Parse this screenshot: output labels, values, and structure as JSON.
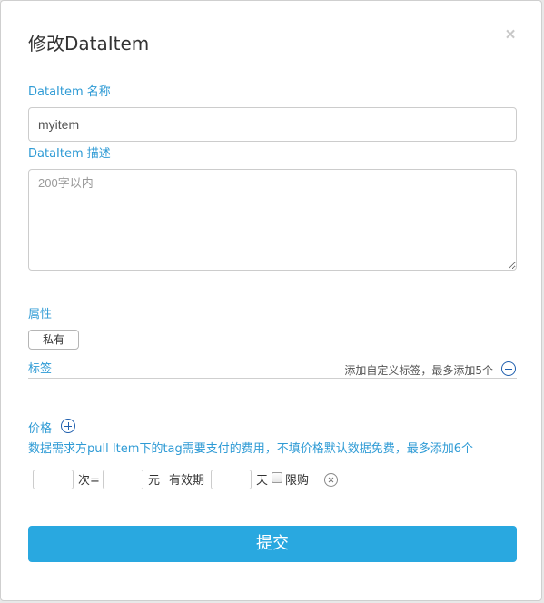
{
  "dialog": {
    "title": "修改DataItem",
    "close_symbol": "×"
  },
  "name_field": {
    "label": "DataItem 名称",
    "value": "myitem"
  },
  "description_field": {
    "label": "DataItem 描述",
    "value": "",
    "placeholder": "200字以内"
  },
  "attributes": {
    "label": "属性",
    "private_button": "私有"
  },
  "tags": {
    "label": "标签",
    "add_hint": "添加自定义标签，最多添加5个"
  },
  "price": {
    "label": "价格",
    "hint": "数据需求方pull Item下的tag需要支付的费用，不填价格默认数据免费，最多添加6个",
    "row": {
      "times_value": "",
      "times_unit": "次=",
      "amount_value": "",
      "currency_unit": "元",
      "validity_label": "有效期",
      "days_value": "",
      "days_unit": "天",
      "limit_label": "限购",
      "limit_checked": false
    }
  },
  "submit_label": "提交",
  "icons": {
    "close": "close-icon",
    "add_tag": "plus-circle-icon",
    "add_price": "plus-circle-icon",
    "remove_price": "remove-circle-icon"
  },
  "colors": {
    "accent_text": "#2f9bd5",
    "primary_button": "#29a8e0",
    "icon_blue": "#1f5fae"
  }
}
